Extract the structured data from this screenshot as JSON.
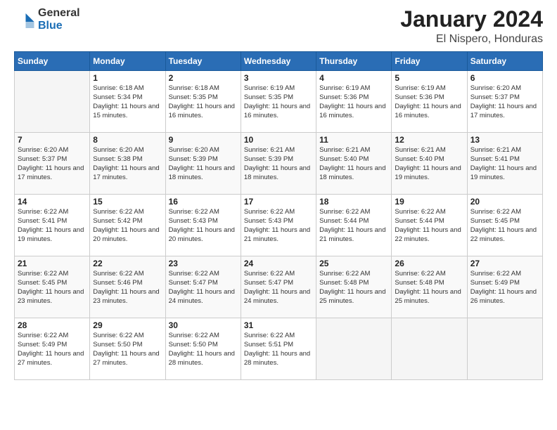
{
  "logo": {
    "general": "General",
    "blue": "Blue"
  },
  "title": "January 2024",
  "subtitle": "El Nispero, Honduras",
  "weekdays": [
    "Sunday",
    "Monday",
    "Tuesday",
    "Wednesday",
    "Thursday",
    "Friday",
    "Saturday"
  ],
  "weeks": [
    [
      {
        "day": null
      },
      {
        "day": "1",
        "sunrise": "6:18 AM",
        "sunset": "5:34 PM",
        "daylight": "11 hours and 15 minutes."
      },
      {
        "day": "2",
        "sunrise": "6:18 AM",
        "sunset": "5:35 PM",
        "daylight": "11 hours and 16 minutes."
      },
      {
        "day": "3",
        "sunrise": "6:19 AM",
        "sunset": "5:35 PM",
        "daylight": "11 hours and 16 minutes."
      },
      {
        "day": "4",
        "sunrise": "6:19 AM",
        "sunset": "5:36 PM",
        "daylight": "11 hours and 16 minutes."
      },
      {
        "day": "5",
        "sunrise": "6:19 AM",
        "sunset": "5:36 PM",
        "daylight": "11 hours and 16 minutes."
      },
      {
        "day": "6",
        "sunrise": "6:20 AM",
        "sunset": "5:37 PM",
        "daylight": "11 hours and 17 minutes."
      }
    ],
    [
      {
        "day": "7",
        "sunrise": "6:20 AM",
        "sunset": "5:37 PM",
        "daylight": "11 hours and 17 minutes."
      },
      {
        "day": "8",
        "sunrise": "6:20 AM",
        "sunset": "5:38 PM",
        "daylight": "11 hours and 17 minutes."
      },
      {
        "day": "9",
        "sunrise": "6:20 AM",
        "sunset": "5:39 PM",
        "daylight": "11 hours and 18 minutes."
      },
      {
        "day": "10",
        "sunrise": "6:21 AM",
        "sunset": "5:39 PM",
        "daylight": "11 hours and 18 minutes."
      },
      {
        "day": "11",
        "sunrise": "6:21 AM",
        "sunset": "5:40 PM",
        "daylight": "11 hours and 18 minutes."
      },
      {
        "day": "12",
        "sunrise": "6:21 AM",
        "sunset": "5:40 PM",
        "daylight": "11 hours and 19 minutes."
      },
      {
        "day": "13",
        "sunrise": "6:21 AM",
        "sunset": "5:41 PM",
        "daylight": "11 hours and 19 minutes."
      }
    ],
    [
      {
        "day": "14",
        "sunrise": "6:22 AM",
        "sunset": "5:41 PM",
        "daylight": "11 hours and 19 minutes."
      },
      {
        "day": "15",
        "sunrise": "6:22 AM",
        "sunset": "5:42 PM",
        "daylight": "11 hours and 20 minutes."
      },
      {
        "day": "16",
        "sunrise": "6:22 AM",
        "sunset": "5:43 PM",
        "daylight": "11 hours and 20 minutes."
      },
      {
        "day": "17",
        "sunrise": "6:22 AM",
        "sunset": "5:43 PM",
        "daylight": "11 hours and 21 minutes."
      },
      {
        "day": "18",
        "sunrise": "6:22 AM",
        "sunset": "5:44 PM",
        "daylight": "11 hours and 21 minutes."
      },
      {
        "day": "19",
        "sunrise": "6:22 AM",
        "sunset": "5:44 PM",
        "daylight": "11 hours and 22 minutes."
      },
      {
        "day": "20",
        "sunrise": "6:22 AM",
        "sunset": "5:45 PM",
        "daylight": "11 hours and 22 minutes."
      }
    ],
    [
      {
        "day": "21",
        "sunrise": "6:22 AM",
        "sunset": "5:45 PM",
        "daylight": "11 hours and 23 minutes."
      },
      {
        "day": "22",
        "sunrise": "6:22 AM",
        "sunset": "5:46 PM",
        "daylight": "11 hours and 23 minutes."
      },
      {
        "day": "23",
        "sunrise": "6:22 AM",
        "sunset": "5:47 PM",
        "daylight": "11 hours and 24 minutes."
      },
      {
        "day": "24",
        "sunrise": "6:22 AM",
        "sunset": "5:47 PM",
        "daylight": "11 hours and 24 minutes."
      },
      {
        "day": "25",
        "sunrise": "6:22 AM",
        "sunset": "5:48 PM",
        "daylight": "11 hours and 25 minutes."
      },
      {
        "day": "26",
        "sunrise": "6:22 AM",
        "sunset": "5:48 PM",
        "daylight": "11 hours and 25 minutes."
      },
      {
        "day": "27",
        "sunrise": "6:22 AM",
        "sunset": "5:49 PM",
        "daylight": "11 hours and 26 minutes."
      }
    ],
    [
      {
        "day": "28",
        "sunrise": "6:22 AM",
        "sunset": "5:49 PM",
        "daylight": "11 hours and 27 minutes."
      },
      {
        "day": "29",
        "sunrise": "6:22 AM",
        "sunset": "5:50 PM",
        "daylight": "11 hours and 27 minutes."
      },
      {
        "day": "30",
        "sunrise": "6:22 AM",
        "sunset": "5:50 PM",
        "daylight": "11 hours and 28 minutes."
      },
      {
        "day": "31",
        "sunrise": "6:22 AM",
        "sunset": "5:51 PM",
        "daylight": "11 hours and 28 minutes."
      },
      {
        "day": null
      },
      {
        "day": null
      },
      {
        "day": null
      }
    ]
  ]
}
